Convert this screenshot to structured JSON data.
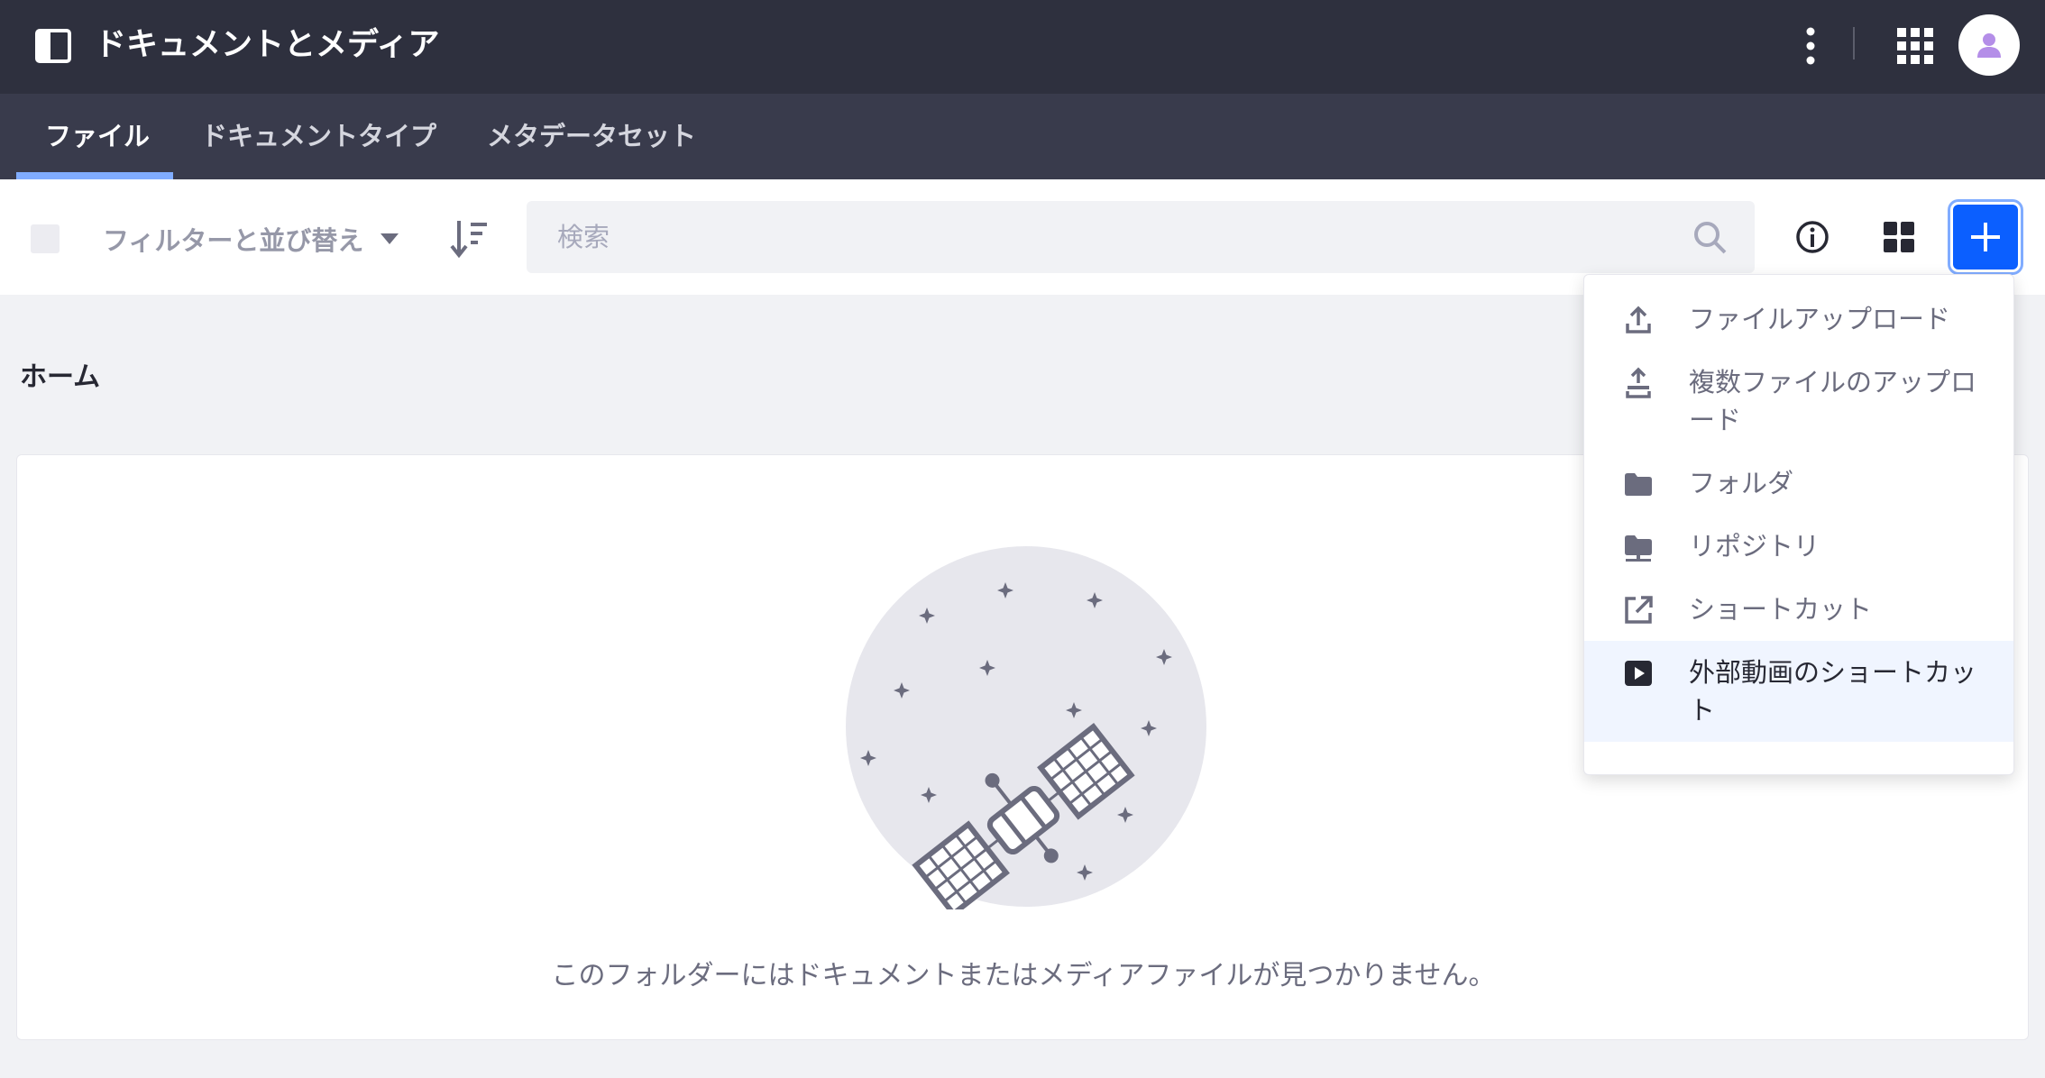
{
  "header": {
    "title": "ドキュメントとメディア",
    "sidebar_toggle_icon": "sidebar-toggle-icon",
    "options_icon": "ellipsis-v-icon",
    "apps_icon": "grid-dots-icon",
    "avatar_icon": "user-icon",
    "avatar_color": "#b48ee8"
  },
  "nav": {
    "tabs": [
      {
        "label": "ファイル",
        "active": true
      },
      {
        "label": "ドキュメントタイプ",
        "active": false
      },
      {
        "label": "メタデータセット",
        "active": false
      }
    ],
    "active_color": "#80acff"
  },
  "toolbar": {
    "filter_label": "フィルターと並び替え",
    "search_placeholder": "検索",
    "search_value": "",
    "accent_color": "#0b5fff"
  },
  "breadcrumb": "ホーム",
  "empty_state": {
    "message": "このフォルダーにはドキュメントまたはメディアファイルが見つかりません。",
    "illustration": "satellite-in-space"
  },
  "add_menu": {
    "items": [
      {
        "label": "ファイルアップロード",
        "icon": "upload-icon"
      },
      {
        "label": "複数ファイルのアップロード",
        "icon": "upload-multiple-icon"
      },
      {
        "label": "フォルダ",
        "icon": "folder-icon"
      },
      {
        "label": "リポジトリ",
        "icon": "repository-icon"
      },
      {
        "label": "ショートカット",
        "icon": "shortcut-icon"
      },
      {
        "label": "外部動画のショートカット",
        "icon": "video-icon",
        "highlighted": true
      }
    ]
  }
}
